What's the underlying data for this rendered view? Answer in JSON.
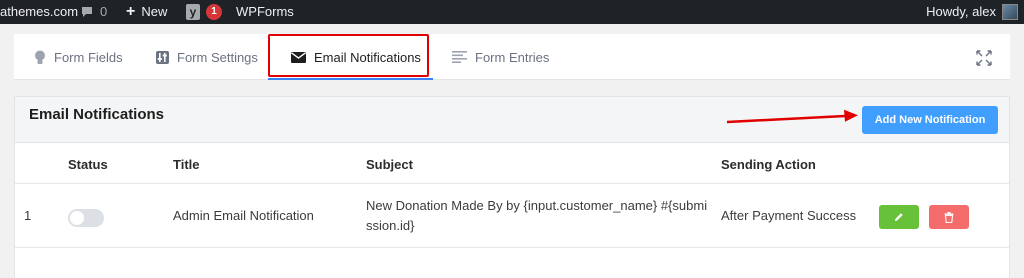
{
  "admin_bar": {
    "site_name": "athemes.com",
    "comments_count": "0",
    "new_label": "New",
    "yoast_badge": "1",
    "wpforms_label": "WPForms",
    "howdy": "Howdy, alex"
  },
  "tabs": [
    {
      "label": "Form Fields",
      "icon": "lightbulb-icon"
    },
    {
      "label": "Form Settings",
      "icon": "sliders-icon"
    },
    {
      "label": "Email Notifications",
      "icon": "envelope-icon",
      "active": true
    },
    {
      "label": "Form Entries",
      "icon": "list-icon"
    }
  ],
  "panel": {
    "title": "Email Notifications",
    "add_button": "Add New Notification"
  },
  "table": {
    "columns": [
      "Status",
      "Title",
      "Subject",
      "Sending Action"
    ],
    "rows": [
      {
        "index": "1",
        "status": false,
        "title": "Admin Email Notification",
        "subject": "New Donation Made By by {input.customer_name} #{submission.id}",
        "sending_action": "After Payment Success"
      }
    ]
  },
  "colors": {
    "accent": "#409eff",
    "edit": "#67c23a",
    "delete": "#f56c6c",
    "highlight": "#e10000"
  }
}
